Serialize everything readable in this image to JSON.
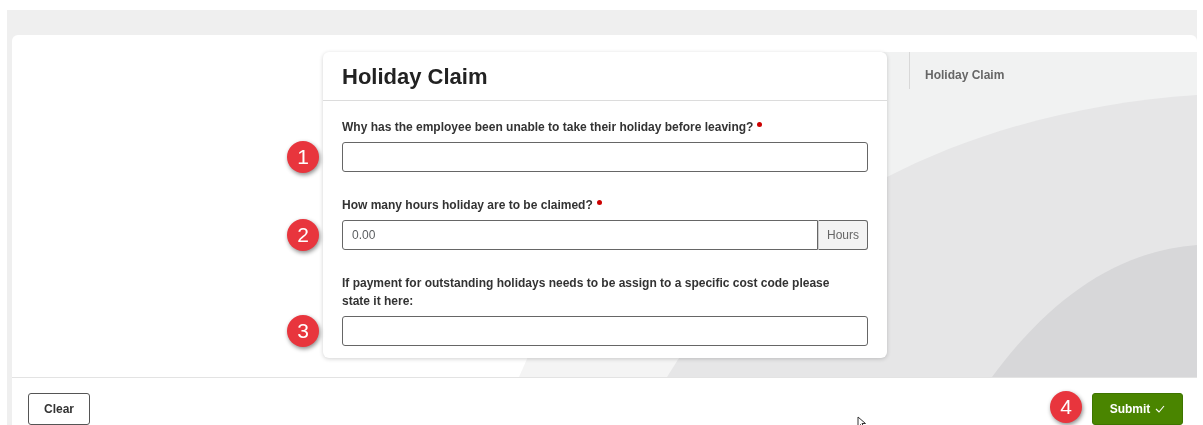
{
  "form": {
    "title": "Holiday Claim",
    "fields": [
      {
        "kind": "text",
        "label": "Why has the employee been unable to take their holiday before leaving?",
        "required": true,
        "callout": "1"
      },
      {
        "kind": "number-with-unit",
        "label": "How many hours holiday are to be claimed?",
        "required": true,
        "placeholder": "0.00",
        "unit": "Hours",
        "callout": "2"
      },
      {
        "kind": "text",
        "label": "If payment for outstanding holidays needs to be assign to a specific cost code please state it here:",
        "required": false,
        "callout": "3"
      }
    ]
  },
  "sidebar": {
    "items": [
      "Holiday Claim"
    ]
  },
  "footer": {
    "clear_button": "Clear",
    "submit_button": "Submit",
    "submit_callout": "4"
  }
}
